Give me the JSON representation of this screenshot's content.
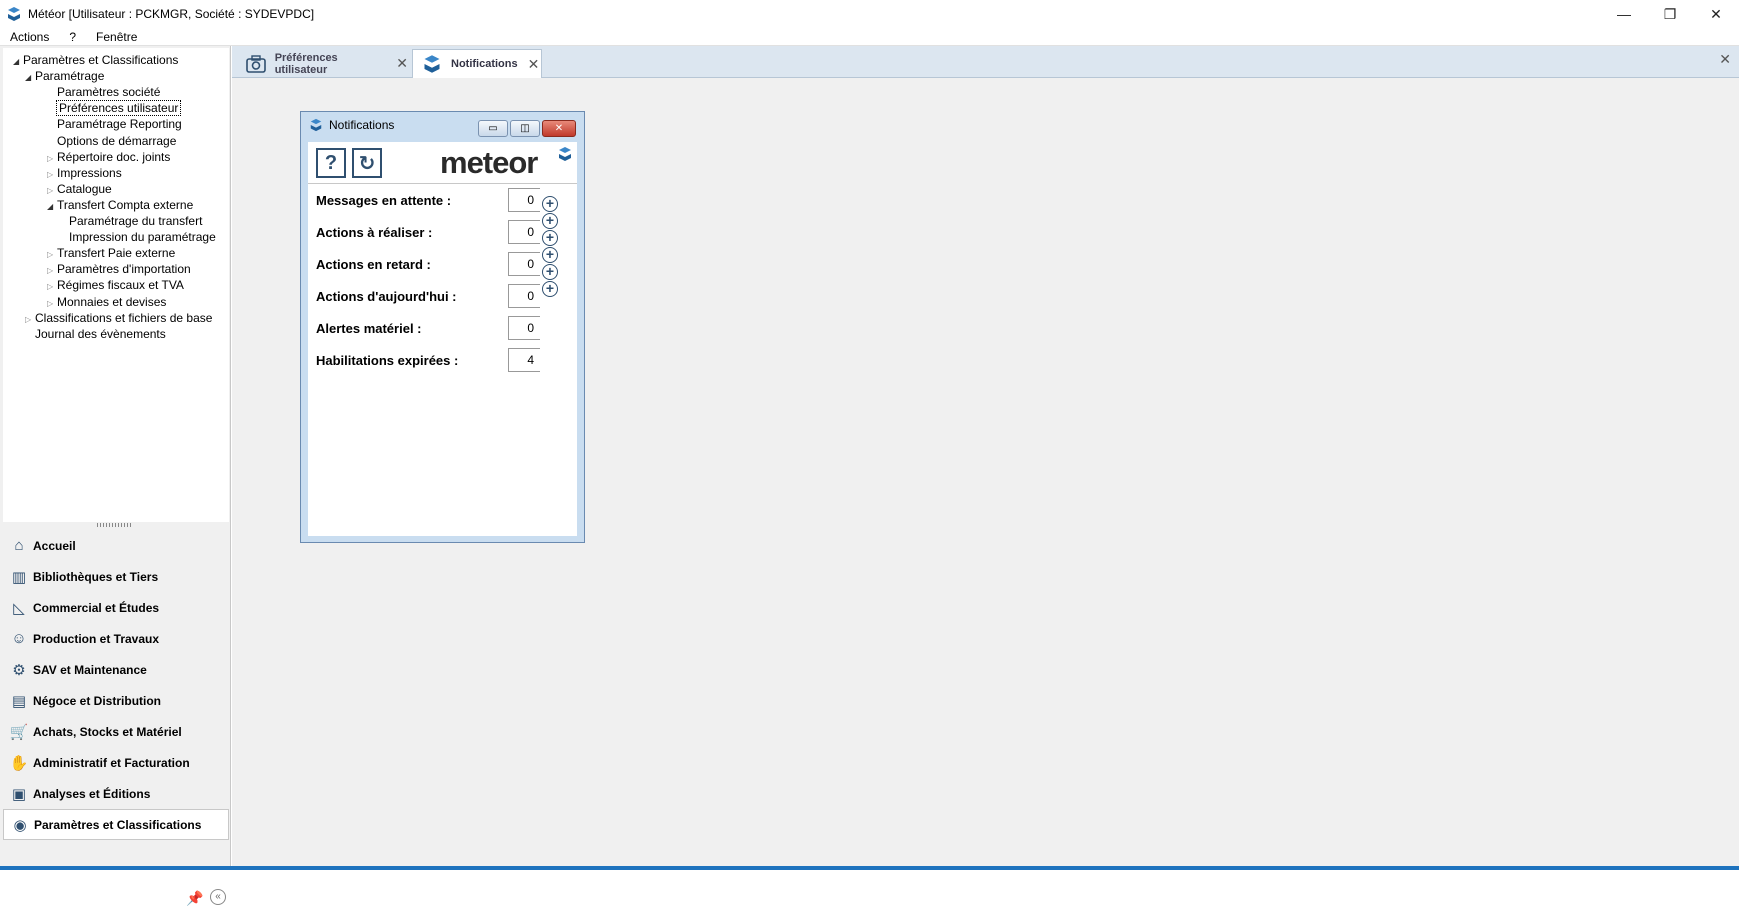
{
  "window": {
    "title": "Météor [Utilisateur : PCKMGR, Société : SYDEVPDC]",
    "controls": {
      "minimize": "—",
      "restore": "❐",
      "close": "✕"
    }
  },
  "menu": {
    "items": [
      "Actions",
      "?",
      "Fenêtre"
    ]
  },
  "tree": {
    "nodes": [
      {
        "label": "Paramètres et Classifications",
        "level": 0,
        "state": "open"
      },
      {
        "label": "Paramétrage",
        "level": 1,
        "state": "open"
      },
      {
        "label": "Paramètres société",
        "level": 2,
        "state": "leaf"
      },
      {
        "label": "Préférences utilisateur",
        "level": 2,
        "state": "leaf",
        "selected": true
      },
      {
        "label": "Paramétrage Reporting",
        "level": 2,
        "state": "leaf"
      },
      {
        "label": "Options de démarrage",
        "level": 2,
        "state": "leaf"
      },
      {
        "label": "Répertoire doc. joints",
        "level": 2,
        "state": "closed"
      },
      {
        "label": "Impressions",
        "level": 2,
        "state": "closed"
      },
      {
        "label": "Catalogue",
        "level": 2,
        "state": "closed"
      },
      {
        "label": "Transfert Compta externe",
        "level": 2,
        "state": "open"
      },
      {
        "label": "Paramétrage du transfert",
        "level": 3,
        "state": "leaf"
      },
      {
        "label": "Impression du paramétrage",
        "level": 3,
        "state": "leaf"
      },
      {
        "label": "Transfert Paie externe",
        "level": 2,
        "state": "closed"
      },
      {
        "label": "Paramètres d'importation",
        "level": 2,
        "state": "closed"
      },
      {
        "label": "Régimes fiscaux et TVA",
        "level": 2,
        "state": "closed"
      },
      {
        "label": "Monnaies et devises",
        "level": 2,
        "state": "closed"
      },
      {
        "label": "Classifications et fichiers de base",
        "level": 1,
        "state": "closed"
      },
      {
        "label": "Journal des évènements",
        "level": 1,
        "state": "leaf"
      }
    ]
  },
  "nav": {
    "items": [
      {
        "label": "Accueil",
        "icon": "home-icon"
      },
      {
        "label": "Bibliothèques et Tiers",
        "icon": "library-icon"
      },
      {
        "label": "Commercial et Études",
        "icon": "ruler-icon"
      },
      {
        "label": "Production et Travaux",
        "icon": "worker-icon"
      },
      {
        "label": "SAV et Maintenance",
        "icon": "gear-icon"
      },
      {
        "label": "Négoce et Distribution",
        "icon": "document-icon"
      },
      {
        "label": "Achats, Stocks et Matériel",
        "icon": "cart-icon"
      },
      {
        "label": "Administratif et Facturation",
        "icon": "coin-hand-icon"
      },
      {
        "label": "Analyses et Éditions",
        "icon": "report-icon"
      },
      {
        "label": "Paramètres et Classifications",
        "icon": "settings-camera-icon",
        "active": true
      }
    ]
  },
  "tabs": [
    {
      "label": "Préférences utilisateur",
      "active": false
    },
    {
      "label": "Notifications",
      "active": true
    }
  ],
  "notifications": {
    "title": "Notifications",
    "logo": "meteor",
    "help_label": "?",
    "refresh_label": "↻",
    "rows": [
      {
        "label": "Messages en attente :",
        "value": "0"
      },
      {
        "label": "Actions à réaliser :",
        "value": "0"
      },
      {
        "label": "Actions en retard :",
        "value": "0"
      },
      {
        "label": "Actions d'aujourd'hui :",
        "value": "0"
      },
      {
        "label": "Alertes matériel :",
        "value": "0"
      },
      {
        "label": "Habilitations expirées :",
        "value": "4"
      }
    ]
  }
}
